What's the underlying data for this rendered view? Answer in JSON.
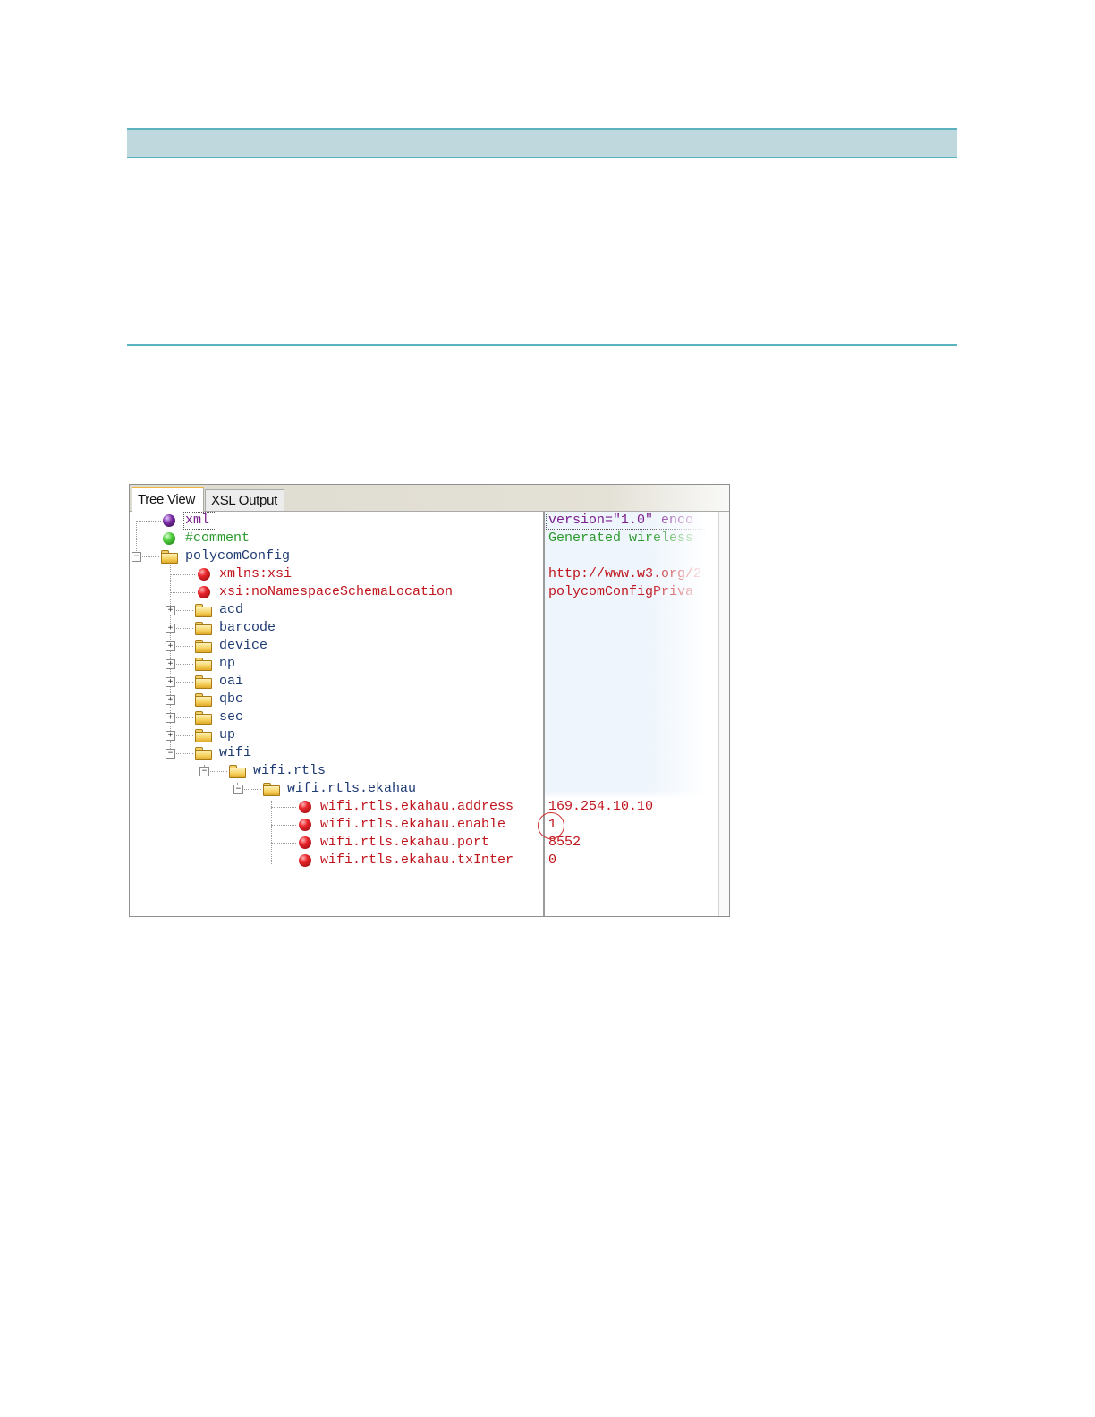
{
  "tabs": [
    {
      "label": "Tree View",
      "active": true
    },
    {
      "label": "XSL Output",
      "active": false
    }
  ],
  "tree": [
    {
      "name": "xml",
      "icon": "purple-ball-icon",
      "value": "version=\"1.0\" enco"
    },
    {
      "name": "#comment",
      "icon": "green-ball-icon",
      "value": "Generated wireless"
    },
    {
      "name": "polycomConfig",
      "icon": "folder-icon",
      "expander": "−",
      "value": ""
    },
    {
      "name": "xmlns:xsi",
      "icon": "red-ball-icon",
      "value": "http://www.w3.org/2"
    },
    {
      "name": "xsi:noNamespaceSchemaLocation",
      "icon": "red-ball-icon",
      "value": "polycomConfigPriva"
    },
    {
      "name": "acd",
      "icon": "folder-icon",
      "expander": "+"
    },
    {
      "name": "barcode",
      "icon": "folder-icon",
      "expander": "+"
    },
    {
      "name": "device",
      "icon": "folder-icon",
      "expander": "+"
    },
    {
      "name": "np",
      "icon": "folder-icon",
      "expander": "+"
    },
    {
      "name": "oai",
      "icon": "folder-icon",
      "expander": "+"
    },
    {
      "name": "qbc",
      "icon": "folder-icon",
      "expander": "+"
    },
    {
      "name": "sec",
      "icon": "folder-icon",
      "expander": "+"
    },
    {
      "name": "up",
      "icon": "folder-icon",
      "expander": "+"
    },
    {
      "name": "wifi",
      "icon": "folder-icon",
      "expander": "−"
    },
    {
      "name": "wifi.rtls",
      "icon": "folder-icon",
      "expander": "−"
    },
    {
      "name": "wifi.rtls.ekahau",
      "icon": "folder-icon",
      "expander": "−"
    },
    {
      "name": "wifi.rtls.ekahau.address",
      "icon": "red-ball-icon",
      "value": "169.254.10.10"
    },
    {
      "name": "wifi.rtls.ekahau.enable",
      "icon": "red-ball-icon",
      "value": "1"
    },
    {
      "name": "wifi.rtls.ekahau.port",
      "icon": "red-ball-icon",
      "value": "8552"
    },
    {
      "name": "wifi.rtls.ekahau.txInter",
      "icon": "red-ball-icon",
      "value": "0"
    }
  ],
  "colors": {
    "band": "#bed8de",
    "band_border": "#5cb3c0",
    "attribute": "#c0151d",
    "element": "#1f4e79",
    "comment": "#2c9a2c",
    "declaration": "#7b1f8f",
    "highlight_circle": "#d03030"
  }
}
